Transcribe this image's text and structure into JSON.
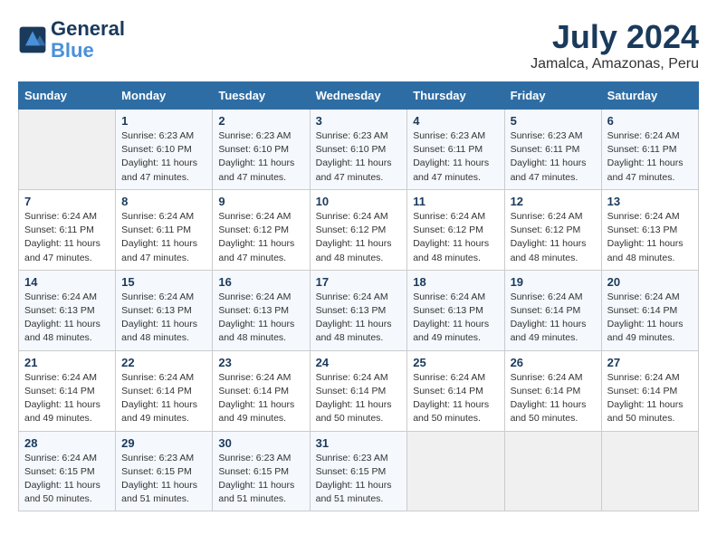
{
  "header": {
    "logo_line1": "General",
    "logo_line2": "Blue",
    "month": "July 2024",
    "location": "Jamalca, Amazonas, Peru"
  },
  "days_of_week": [
    "Sunday",
    "Monday",
    "Tuesday",
    "Wednesday",
    "Thursday",
    "Friday",
    "Saturday"
  ],
  "weeks": [
    [
      {
        "day": "",
        "detail": ""
      },
      {
        "day": "1",
        "detail": "Sunrise: 6:23 AM\nSunset: 6:10 PM\nDaylight: 11 hours\nand 47 minutes."
      },
      {
        "day": "2",
        "detail": "Sunrise: 6:23 AM\nSunset: 6:10 PM\nDaylight: 11 hours\nand 47 minutes."
      },
      {
        "day": "3",
        "detail": "Sunrise: 6:23 AM\nSunset: 6:10 PM\nDaylight: 11 hours\nand 47 minutes."
      },
      {
        "day": "4",
        "detail": "Sunrise: 6:23 AM\nSunset: 6:11 PM\nDaylight: 11 hours\nand 47 minutes."
      },
      {
        "day": "5",
        "detail": "Sunrise: 6:23 AM\nSunset: 6:11 PM\nDaylight: 11 hours\nand 47 minutes."
      },
      {
        "day": "6",
        "detail": "Sunrise: 6:24 AM\nSunset: 6:11 PM\nDaylight: 11 hours\nand 47 minutes."
      }
    ],
    [
      {
        "day": "7",
        "detail": "Sunrise: 6:24 AM\nSunset: 6:11 PM\nDaylight: 11 hours\nand 47 minutes."
      },
      {
        "day": "8",
        "detail": "Sunrise: 6:24 AM\nSunset: 6:11 PM\nDaylight: 11 hours\nand 47 minutes."
      },
      {
        "day": "9",
        "detail": "Sunrise: 6:24 AM\nSunset: 6:12 PM\nDaylight: 11 hours\nand 47 minutes."
      },
      {
        "day": "10",
        "detail": "Sunrise: 6:24 AM\nSunset: 6:12 PM\nDaylight: 11 hours\nand 48 minutes."
      },
      {
        "day": "11",
        "detail": "Sunrise: 6:24 AM\nSunset: 6:12 PM\nDaylight: 11 hours\nand 48 minutes."
      },
      {
        "day": "12",
        "detail": "Sunrise: 6:24 AM\nSunset: 6:12 PM\nDaylight: 11 hours\nand 48 minutes."
      },
      {
        "day": "13",
        "detail": "Sunrise: 6:24 AM\nSunset: 6:13 PM\nDaylight: 11 hours\nand 48 minutes."
      }
    ],
    [
      {
        "day": "14",
        "detail": "Sunrise: 6:24 AM\nSunset: 6:13 PM\nDaylight: 11 hours\nand 48 minutes."
      },
      {
        "day": "15",
        "detail": "Sunrise: 6:24 AM\nSunset: 6:13 PM\nDaylight: 11 hours\nand 48 minutes."
      },
      {
        "day": "16",
        "detail": "Sunrise: 6:24 AM\nSunset: 6:13 PM\nDaylight: 11 hours\nand 48 minutes."
      },
      {
        "day": "17",
        "detail": "Sunrise: 6:24 AM\nSunset: 6:13 PM\nDaylight: 11 hours\nand 48 minutes."
      },
      {
        "day": "18",
        "detail": "Sunrise: 6:24 AM\nSunset: 6:13 PM\nDaylight: 11 hours\nand 49 minutes."
      },
      {
        "day": "19",
        "detail": "Sunrise: 6:24 AM\nSunset: 6:14 PM\nDaylight: 11 hours\nand 49 minutes."
      },
      {
        "day": "20",
        "detail": "Sunrise: 6:24 AM\nSunset: 6:14 PM\nDaylight: 11 hours\nand 49 minutes."
      }
    ],
    [
      {
        "day": "21",
        "detail": "Sunrise: 6:24 AM\nSunset: 6:14 PM\nDaylight: 11 hours\nand 49 minutes."
      },
      {
        "day": "22",
        "detail": "Sunrise: 6:24 AM\nSunset: 6:14 PM\nDaylight: 11 hours\nand 49 minutes."
      },
      {
        "day": "23",
        "detail": "Sunrise: 6:24 AM\nSunset: 6:14 PM\nDaylight: 11 hours\nand 49 minutes."
      },
      {
        "day": "24",
        "detail": "Sunrise: 6:24 AM\nSunset: 6:14 PM\nDaylight: 11 hours\nand 50 minutes."
      },
      {
        "day": "25",
        "detail": "Sunrise: 6:24 AM\nSunset: 6:14 PM\nDaylight: 11 hours\nand 50 minutes."
      },
      {
        "day": "26",
        "detail": "Sunrise: 6:24 AM\nSunset: 6:14 PM\nDaylight: 11 hours\nand 50 minutes."
      },
      {
        "day": "27",
        "detail": "Sunrise: 6:24 AM\nSunset: 6:14 PM\nDaylight: 11 hours\nand 50 minutes."
      }
    ],
    [
      {
        "day": "28",
        "detail": "Sunrise: 6:24 AM\nSunset: 6:15 PM\nDaylight: 11 hours\nand 50 minutes."
      },
      {
        "day": "29",
        "detail": "Sunrise: 6:23 AM\nSunset: 6:15 PM\nDaylight: 11 hours\nand 51 minutes."
      },
      {
        "day": "30",
        "detail": "Sunrise: 6:23 AM\nSunset: 6:15 PM\nDaylight: 11 hours\nand 51 minutes."
      },
      {
        "day": "31",
        "detail": "Sunrise: 6:23 AM\nSunset: 6:15 PM\nDaylight: 11 hours\nand 51 minutes."
      },
      {
        "day": "",
        "detail": ""
      },
      {
        "day": "",
        "detail": ""
      },
      {
        "day": "",
        "detail": ""
      }
    ]
  ]
}
